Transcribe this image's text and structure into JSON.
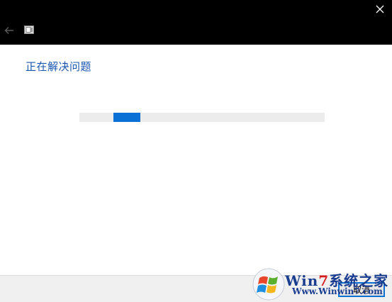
{
  "titlebar": {
    "close_icon": "close-icon",
    "back_icon": "back-arrow-icon",
    "app_icon": "troubleshooter-icon"
  },
  "main": {
    "heading": "正在解决问题",
    "progress": {
      "indeterminate": true,
      "chunk_position_fraction": 0.14,
      "chunk_width_fraction": 0.11
    }
  },
  "footer": {
    "cancel_label": "取消"
  },
  "watermark": {
    "title_prefix": "Win",
    "title_seven": "7",
    "title_suffix": "系统之家",
    "url": "Www.Winwin7.com"
  },
  "colors": {
    "titlebar": "#000000",
    "accent": "#0a70d6",
    "heading": "#1a56b0",
    "track": "#ececec",
    "footer": "#f0f0f0"
  }
}
